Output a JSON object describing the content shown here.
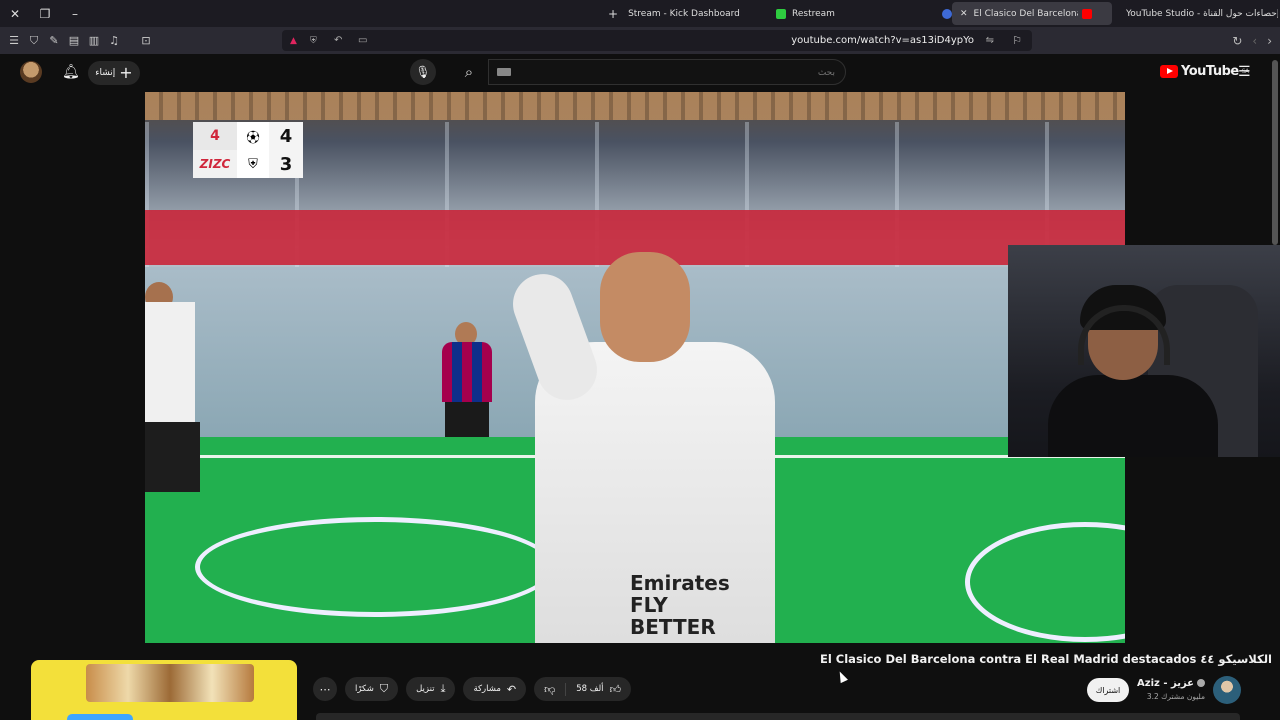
{
  "browser": {
    "tabs": [
      {
        "title": "Stream - Kick Dashboard",
        "active": false
      },
      {
        "title": "Restream",
        "active": false
      },
      {
        "title": "El Clasico Del Barcelona contra",
        "active": true
      },
      {
        "title": "YouTube Studio - إحصاءات حول القناة",
        "active": false
      }
    ],
    "url": "youtube.com/watch?v=as13iD4ypYo"
  },
  "youtube": {
    "create_label": "إنشاء",
    "search_placeholder": "بحث",
    "logo_text": "YouTube",
    "logo_region": "SA"
  },
  "scoreboard": {
    "team1_score": "4",
    "team2_score": "3",
    "league1": "4",
    "league2": "ZIZC"
  },
  "video": {
    "title": "El Clasico Del Barcelona contra El Real Madrid destacados الكلاسيكو ٤٤",
    "shirt_text": "Emirates FLY BETTER"
  },
  "actions": {
    "thanks_label": "شكرًا",
    "download_label": "تنزيل",
    "share_label": "مشاركة",
    "likes": "58 ألف"
  },
  "channel": {
    "name": "Aziz - عزيز",
    "subscribers": "3.2 مليون مشترك",
    "subscribe_label": "اشتراك"
  },
  "colors": {
    "background": "#0f0f0f",
    "accent_red": "#ff0000",
    "ad_yellow": "#f3e03a"
  }
}
